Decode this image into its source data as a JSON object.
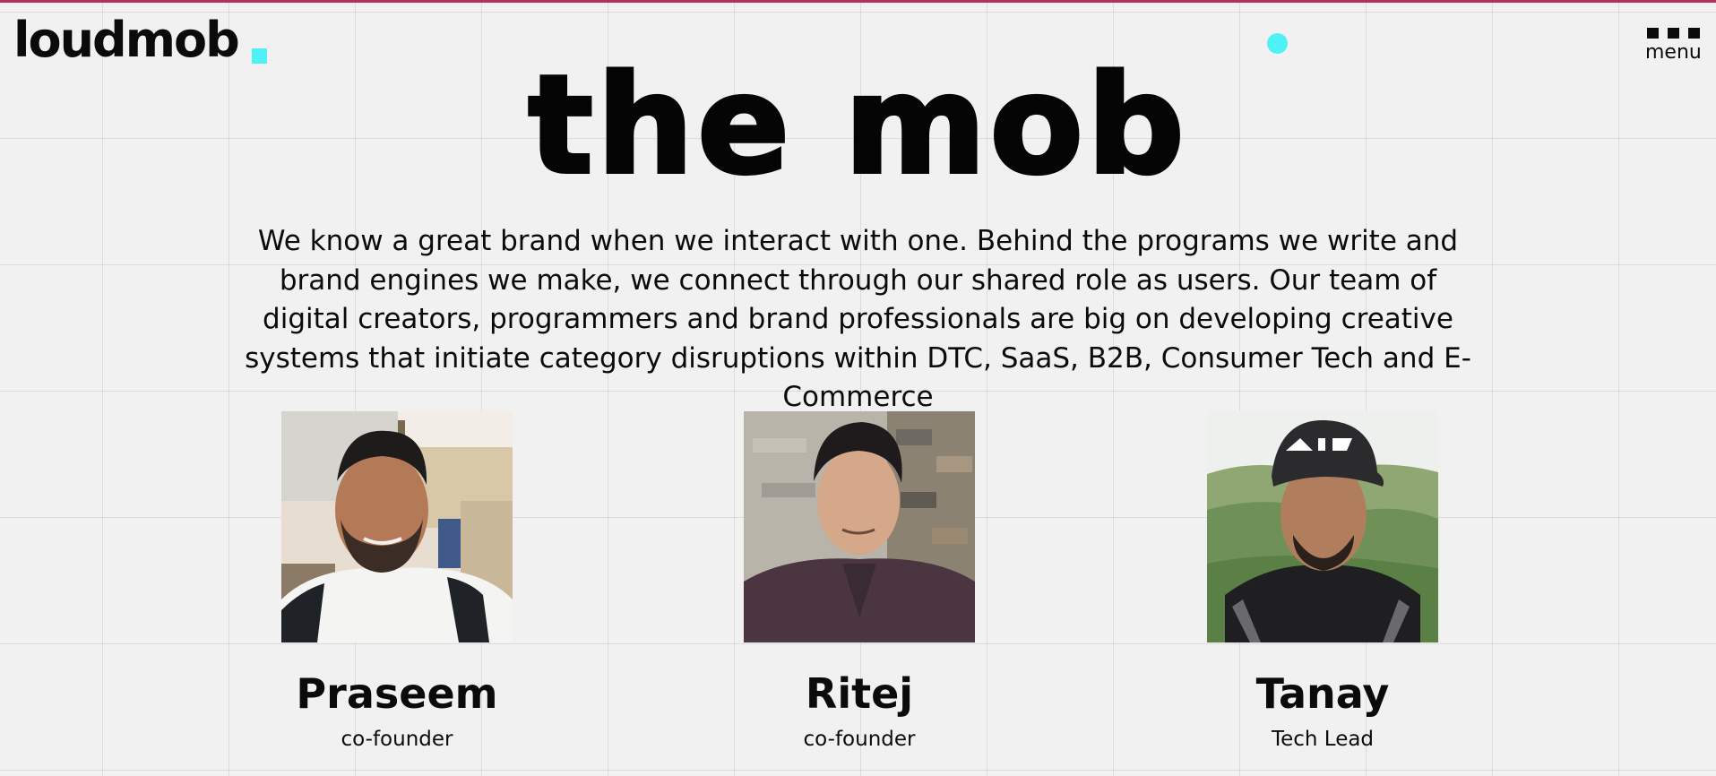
{
  "header": {
    "logo_text": "loudmob",
    "menu_label": "menu"
  },
  "colors": {
    "accent": "#4ff2f4",
    "background": "#f1f1f1",
    "text": "#0b0b0b",
    "top_strip": "#b03060"
  },
  "main": {
    "title": "the mob",
    "intro": "We know a great brand when we interact with one. Behind the programs we write and brand engines we make, we connect through our shared role as users. Our team of digital creators, programmers and brand professionals are big on developing creative systems that initiate category disruptions within DTC, SaaS, B2B, Consumer Tech and E-Commerce"
  },
  "team": [
    {
      "name": "Praseem",
      "role": "co-founder"
    },
    {
      "name": "Ritej",
      "role": "co-founder"
    },
    {
      "name": "Tanay",
      "role": "Tech Lead"
    }
  ]
}
